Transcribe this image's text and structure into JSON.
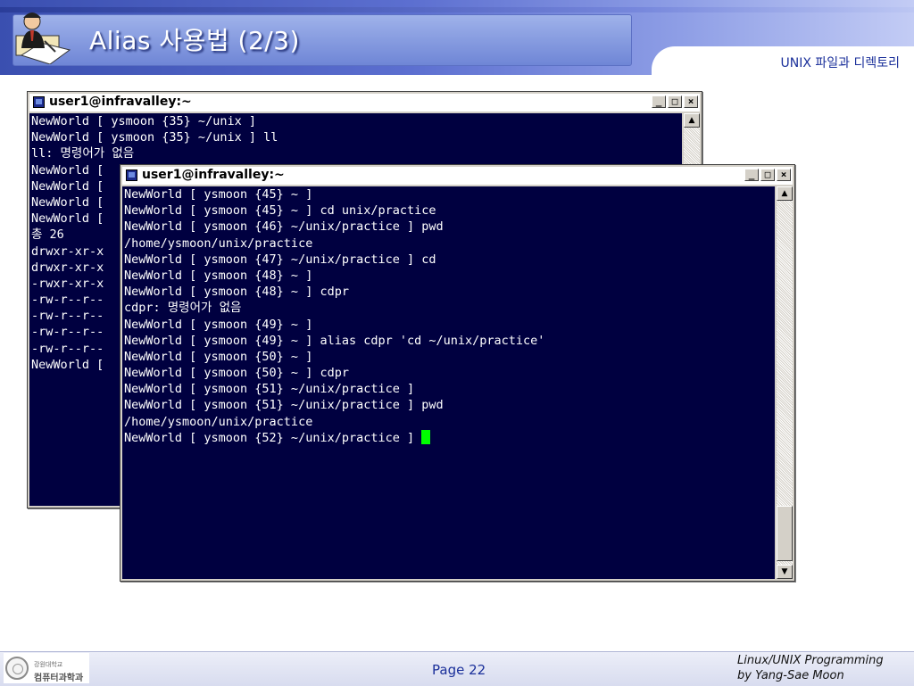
{
  "slide": {
    "title": "Alias 사용법 (2/3)",
    "subtitle": "UNIX 파일과 디렉토리"
  },
  "window_back": {
    "title": "user1@infravalley:~",
    "lines": [
      "NewWorld [ ysmoon {35} ~/unix ]",
      "NewWorld [ ysmoon {35} ~/unix ] ll",
      "ll: 명령어가 없음",
      "NewWorld [ ",
      "NewWorld [ ",
      "NewWorld [ ",
      "NewWorld [ ",
      "총 26",
      "drwxr-xr-x",
      "drwxr-xr-x",
      "-rwxr-xr-x",
      "-rw-r--r--",
      "-rw-r--r--",
      "-rw-r--r--",
      "-rw-r--r--",
      "NewWorld [ "
    ]
  },
  "window_front": {
    "title": "user1@infravalley:~",
    "lines": [
      "NewWorld [ ysmoon {45} ~ ]",
      "NewWorld [ ysmoon {45} ~ ] cd unix/practice",
      "NewWorld [ ysmoon {46} ~/unix/practice ] pwd",
      "/home/ysmoon/unix/practice",
      "NewWorld [ ysmoon {47} ~/unix/practice ] cd",
      "NewWorld [ ysmoon {48} ~ ]",
      "NewWorld [ ysmoon {48} ~ ] cdpr",
      "cdpr: 명령어가 없음",
      "NewWorld [ ysmoon {49} ~ ]",
      "NewWorld [ ysmoon {49} ~ ] alias cdpr 'cd ~/unix/practice'",
      "NewWorld [ ysmoon {50} ~ ]",
      "NewWorld [ ysmoon {50} ~ ] cdpr",
      "NewWorld [ ysmoon {51} ~/unix/practice ]",
      "NewWorld [ ysmoon {51} ~/unix/practice ] pwd",
      "/home/ysmoon/unix/practice",
      "NewWorld [ ysmoon {52} ~/unix/practice ] "
    ]
  },
  "window_buttons": {
    "minimize": "_",
    "maximize": "□",
    "close": "×",
    "scroll_up": "▲",
    "scroll_down": "▼"
  },
  "footer": {
    "school_small": "강원대학교",
    "school_dept": "컴퓨터과학과",
    "page": "Page 22",
    "credit_line1": "Linux/UNIX Programming",
    "credit_line2": "by Yang-Sae Moon"
  },
  "colors": {
    "terminal_bg": "#000040",
    "terminal_fg": "#ffffff",
    "cursor": "#00ff00",
    "header_blue": "#3a4fb0",
    "subtitle_blue": "#1a2f9a"
  },
  "icons": {
    "header_logo": "teacher-at-desk-icon",
    "window_icon": "terminal-window-icon",
    "footer_seal": "university-seal-icon"
  }
}
